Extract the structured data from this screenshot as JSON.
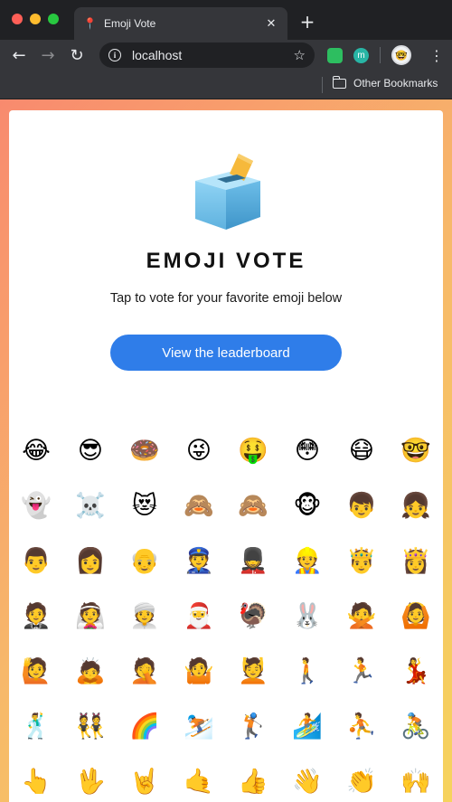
{
  "browser": {
    "tab": {
      "title": "Emoji Vote",
      "favicon": "map-pin-icon"
    },
    "address": {
      "url": "localhost"
    },
    "bookmarks": {
      "folder_label": "Other Bookmarks"
    },
    "colors": {
      "chrome_dark": "#202124",
      "chrome_toolbar": "#35363a"
    }
  },
  "page": {
    "title": "EMOJI VOTE",
    "subtitle": "Tap to vote for your favorite emoji below",
    "leaderboard_button": "View the leaderboard",
    "ballot_icon": "ballot-box-icon",
    "colors": {
      "button": "#2f7de9",
      "gradient_start": "#f88a6e",
      "gradient_end": "#f6d35d"
    },
    "emojis": [
      "😂",
      "😎",
      "🍩",
      "😜",
      "🤑",
      "😳",
      "😷",
      "🤓",
      "👻",
      "☠️",
      "😻",
      "🙈",
      "🙈",
      "🐵",
      "👦",
      "👧",
      "👨",
      "👩",
      "👴",
      "👮",
      "💂",
      "👷",
      "🤴",
      "👸",
      "🤵",
      "👰",
      "👳",
      "🎅",
      "🦃",
      "🐰",
      "🙅",
      "🙆",
      "🙋",
      "🙇",
      "🤦",
      "🤷",
      "💆",
      "🚶",
      "🏃",
      "💃",
      "🕺",
      "👯",
      "🌈",
      "⛷️",
      "🏌️",
      "🏄",
      "⛹️",
      "🚴",
      "👆",
      "🖖",
      "🤘",
      "🤙",
      "👍",
      "👋",
      "👏",
      "🙌"
    ]
  }
}
